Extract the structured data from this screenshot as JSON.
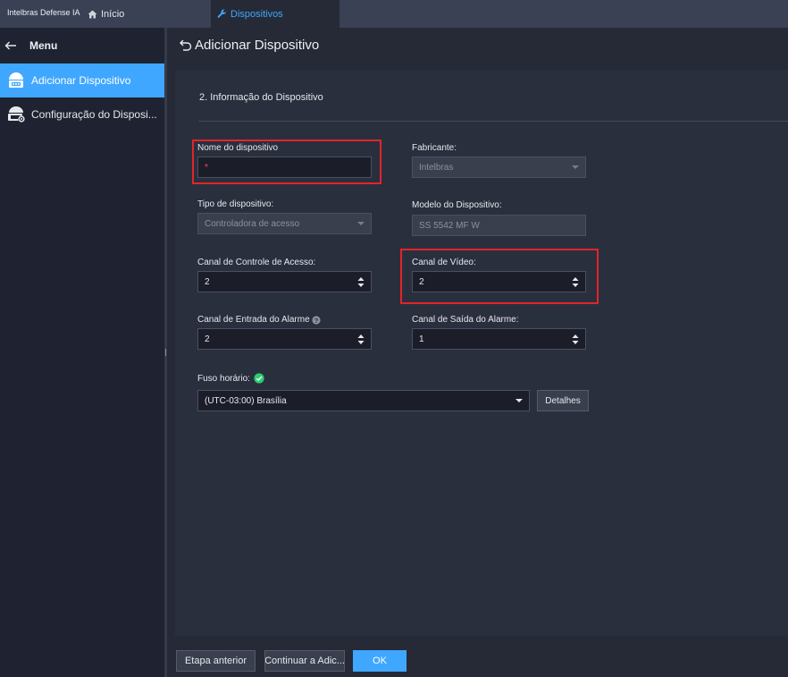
{
  "topbar": {
    "brand": "Intelbras Defense IA",
    "tabs": [
      {
        "label": "Início",
        "icon": "home-icon"
      },
      {
        "label": "Dispositivos",
        "icon": "wrench-icon",
        "active": true
      }
    ]
  },
  "sidebar": {
    "menu_label": "Menu",
    "items": [
      {
        "label": "Adicionar Dispositivo",
        "icon": "add-device-icon",
        "active": true
      },
      {
        "label": "Configuração do Disposi...",
        "icon": "device-config-icon",
        "active": false
      }
    ]
  },
  "main": {
    "title": "Adicionar Dispositivo",
    "section_title": "2. Informação do Dispositivo",
    "form": {
      "device_name": {
        "label": "Nome do dispositivo",
        "value": "",
        "required_mark": "*"
      },
      "manufacturer": {
        "label": "Fabricante:",
        "value": "Intelbras"
      },
      "device_type": {
        "label": "Tipo de dispositivo:",
        "value": "Controladora de acesso"
      },
      "device_model": {
        "label": "Modelo do Dispositivo:",
        "value": "SS 5542 MF W"
      },
      "access_control_channel": {
        "label": "Canal de Controle de Acesso:",
        "value": "2"
      },
      "video_channel": {
        "label": "Canal de Vídeo:",
        "value": "2"
      },
      "alarm_input_channel": {
        "label": "Canal de Entrada do Alarme",
        "value": "2"
      },
      "alarm_output_channel": {
        "label": "Canal de Saída do Alarme:",
        "value": "1"
      },
      "timezone": {
        "label": "Fuso horário:",
        "value": "(UTC-03:00) Brasília",
        "details_label": "Detalhes"
      }
    }
  },
  "footer": {
    "prev_label": "Etapa anterior",
    "continue_label": "Continuar a Adic...",
    "ok_label": "OK"
  },
  "colors": {
    "accent": "#3fa7ff",
    "highlight": "#e0252a",
    "success": "#2ecc71"
  }
}
